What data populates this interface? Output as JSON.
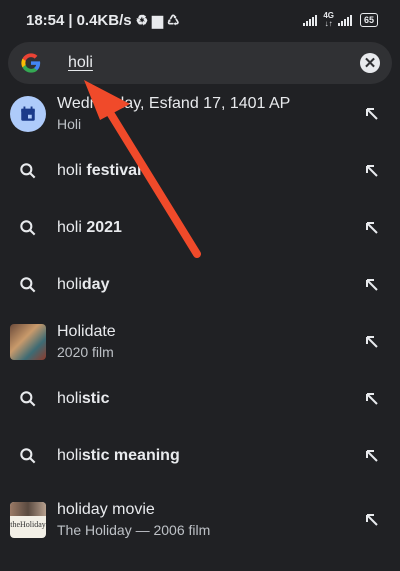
{
  "status": {
    "time": "18:54",
    "speed": "0.4KB/s",
    "net_top": "4G",
    "net_bottom": "↓↑",
    "battery": "65"
  },
  "search": {
    "query": "holi",
    "clear_label": "✕"
  },
  "suggestions": [
    {
      "type": "calendar",
      "title": "Wednesday, Esfand 17, 1401 AP",
      "subtitle": "Holi"
    },
    {
      "type": "search",
      "prefix": "holi ",
      "bold": "festival",
      "subtitle": ""
    },
    {
      "type": "search",
      "prefix": "holi ",
      "bold": "2021",
      "subtitle": ""
    },
    {
      "type": "search",
      "prefix": "holi",
      "bold": "day",
      "subtitle": ""
    },
    {
      "type": "movie",
      "title": "Holidate",
      "subtitle": "2020 film"
    },
    {
      "type": "search",
      "prefix": "holi",
      "bold": "stic",
      "subtitle": ""
    },
    {
      "type": "search",
      "prefix": "holi",
      "bold": "stic meaning",
      "subtitle": ""
    },
    {
      "type": "movie2",
      "title": "holiday movie",
      "subtitle": "The Holiday — 2006 film",
      "thumb_text": "theHoliday"
    }
  ],
  "colors": {
    "background": "#202124",
    "search_bar": "#303134",
    "annotation_arrow": "#f04a2a"
  }
}
